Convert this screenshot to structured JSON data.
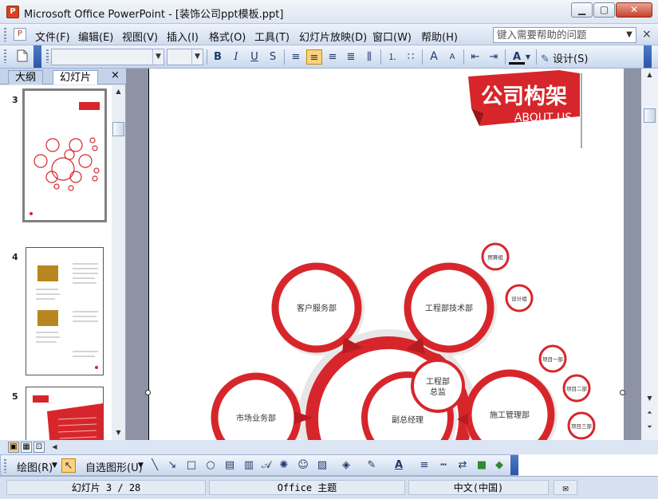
{
  "window": {
    "title": "Microsoft Office PowerPoint - [装饰公司ppt模板.ppt]",
    "app_icon_glyph": "P",
    "min_glyph": "▁",
    "max_glyph": "▢",
    "close_glyph": "✕"
  },
  "menu": {
    "items": [
      "文件(F)",
      "编辑(E)",
      "视图(V)",
      "插入(I)",
      "格式(O)",
      "工具(T)",
      "幻灯片放映(D)",
      "窗口(W)",
      "帮助(H)"
    ],
    "help_placeholder": "键入需要帮助的问题",
    "help_arrow": "▼",
    "close_glyph": "×"
  },
  "toolbar": {
    "new_icon": "new-document-icon",
    "bold": "B",
    "italic": "I",
    "underline": "U",
    "shadow": "S",
    "align_left": "≡",
    "align_center": "≡",
    "align_right": "≡",
    "justify": "≣",
    "distributed": "⫼",
    "numbering": "⒈",
    "bullets": "∷",
    "grow_font": "A",
    "shrink_font": "A",
    "decrease_indent": "⇤",
    "increase_indent": "⇥",
    "font_color": "A",
    "design_label": "设计(S)",
    "active_color": "#ffd27a"
  },
  "left_pane": {
    "tab_outline": "大纲",
    "tab_slides": "幻灯片",
    "close_glyph": "×",
    "slides": [
      {
        "number": "3",
        "selected": true
      },
      {
        "number": "4",
        "selected": false
      },
      {
        "number": "5",
        "selected": false
      }
    ]
  },
  "slide": {
    "banner_title": "公司构架",
    "banner_subtitle": "ABOUT US",
    "accent_color": "#d7262b",
    "nodes": {
      "customer_service": "客户服务部",
      "engineering_tech": "工程部技术部",
      "engineering_director_1": "工程部",
      "engineering_director_2": "总监",
      "deputy_gm": "副总经理",
      "construction_mgmt": "施工管理部",
      "marketing": "市场业务部",
      "budget": "预算组",
      "design": "设计组",
      "project1": "项目一部",
      "project2": "项目二部",
      "project3": "项目三部"
    }
  },
  "drawbar": {
    "draw_label": "绘图(R)",
    "autoshape_label": "自选图形(U)"
  },
  "status": {
    "slide_info": "幻灯片 3 / 28",
    "theme": "Office 主题",
    "language": "中文(中国)"
  }
}
